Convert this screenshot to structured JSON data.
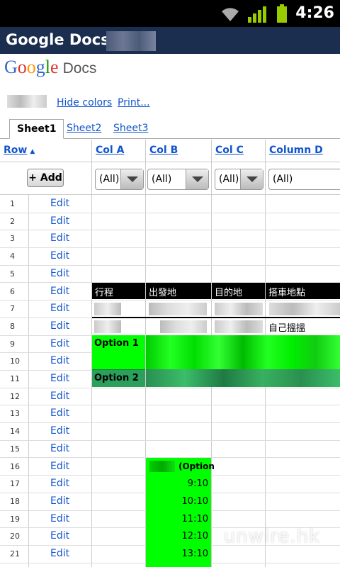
{
  "status_bar": {
    "time": "4:26"
  },
  "title_bar": {
    "title": "Google Docs -"
  },
  "logo": {
    "google": "Google",
    "docs": "Docs"
  },
  "links": {
    "hide_colors": "Hide colors",
    "print": "Print..."
  },
  "tabs": [
    {
      "label": "Sheet1",
      "active": true
    },
    {
      "label": "Sheet2"
    },
    {
      "label": "Sheet3"
    }
  ],
  "columns": {
    "row": "Row",
    "sort_arrow": "▲",
    "col_a": "Col A",
    "col_b": "Col B",
    "col_c": "Col C",
    "col_d": "Column D"
  },
  "add_button": "+ Add",
  "filters": {
    "a": "(All)",
    "b": "(All)",
    "c": "(All)",
    "d": "(All)"
  },
  "rows": [
    {
      "num": "1",
      "edit": "Edit"
    },
    {
      "num": "2",
      "edit": "Edit"
    },
    {
      "num": "3",
      "edit": "Edit"
    },
    {
      "num": "4",
      "edit": "Edit"
    },
    {
      "num": "5",
      "edit": "Edit"
    },
    {
      "num": "6",
      "edit": "Edit"
    },
    {
      "num": "7",
      "edit": "Edit"
    },
    {
      "num": "8",
      "edit": "Edit"
    },
    {
      "num": "9",
      "edit": "Edit"
    },
    {
      "num": "10",
      "edit": "Edit"
    },
    {
      "num": "11",
      "edit": "Edit"
    },
    {
      "num": "12",
      "edit": "Edit"
    },
    {
      "num": "13",
      "edit": "Edit"
    },
    {
      "num": "14",
      "edit": "Edit"
    },
    {
      "num": "15",
      "edit": "Edit"
    },
    {
      "num": "16",
      "edit": "Edit"
    },
    {
      "num": "17",
      "edit": "Edit"
    },
    {
      "num": "18",
      "edit": "Edit"
    },
    {
      "num": "19",
      "edit": "Edit"
    },
    {
      "num": "20",
      "edit": "Edit"
    },
    {
      "num": "21",
      "edit": "Edit"
    }
  ],
  "cells": {
    "r6": {
      "a": "行程",
      "b": "出發地",
      "c": "目的地",
      "d": "搭車地點"
    },
    "r8": {
      "d": "自己搵搵"
    },
    "r9": {
      "a": "Option 1"
    },
    "r11": {
      "a": "Option 2"
    },
    "r16": {
      "b": "(Option"
    },
    "times": [
      "9:10",
      "10:10",
      "11:10",
      "12:10",
      "13:10"
    ]
  },
  "watermark": "unwire.hk",
  "colors": {
    "title_bg": "#1b2e4f",
    "link": "#1155cc",
    "green": "#00ff00",
    "dark_green": "#2d9f5c"
  }
}
